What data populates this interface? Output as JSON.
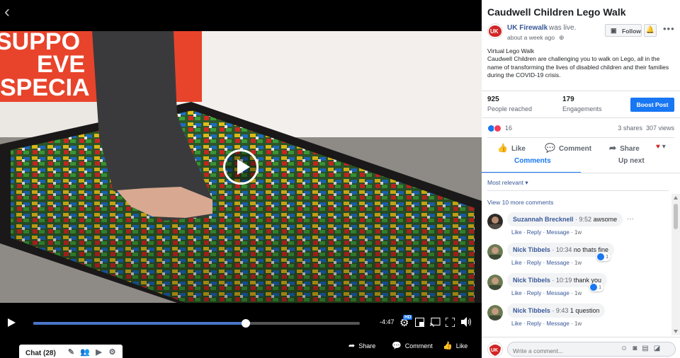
{
  "video": {
    "back_icon": "back-arrow-icon",
    "time_remaining": "-4:47",
    "progress_percent": 65,
    "hd_label": "HD",
    "chat_label": "Chat (28)",
    "share_label": "Share",
    "comment_label": "Comment",
    "like_label": "Like"
  },
  "post": {
    "title": "Caudwell Children Lego Walk",
    "page_name": "UK Firewalk",
    "status": "was live.",
    "time": "about a week ago",
    "follow_label": "Follow",
    "text_line1": "Virtual Lego Walk",
    "text_body": "Caudwell Children are challenging you to walk on Lego, all in the name of transforming the lives of disabled children and their families during the COVID-19 crisis."
  },
  "stats": {
    "people_reached_value": "925",
    "people_reached_label": "People reached",
    "engagements_value": "179",
    "engagements_label": "Engagements",
    "boost_label": "Boost Post",
    "reactions_count": "16",
    "shares": "3 shares",
    "views": "307 views"
  },
  "actions": {
    "like": "Like",
    "comment": "Comment",
    "share": "Share"
  },
  "tabs": {
    "comments": "Comments",
    "up_next": "Up next"
  },
  "comments_section": {
    "sort_label": "Most relevant",
    "view_more": "View 10 more comments",
    "items": [
      {
        "author": "Suzannah Brecknell",
        "time": "9:52",
        "text": "awsome",
        "like": "Like",
        "reply": "Reply",
        "message": "Message",
        "age": "1w",
        "reactions": ""
      },
      {
        "author": "Nick Tibbels",
        "time": "10:34",
        "text": "no thats fine",
        "like": "Like",
        "reply": "Reply",
        "message": "Message",
        "age": "1w",
        "reactions": "1"
      },
      {
        "author": "Nick Tibbels",
        "time": "10:19",
        "text": "thank you",
        "like": "Like",
        "reply": "Reply",
        "message": "Message",
        "age": "1w",
        "reactions": "1"
      },
      {
        "author": "Nick Tibbels",
        "time": "9:43",
        "text": "1 question",
        "like": "Like",
        "reply": "Reply",
        "message": "Message",
        "age": "1w",
        "reactions": ""
      }
    ],
    "composer_placeholder": "Write a comment..."
  },
  "colors": {
    "brand_blue": "#1877f2",
    "link_blue": "#385898",
    "progress_blue": "#4a76c9"
  }
}
